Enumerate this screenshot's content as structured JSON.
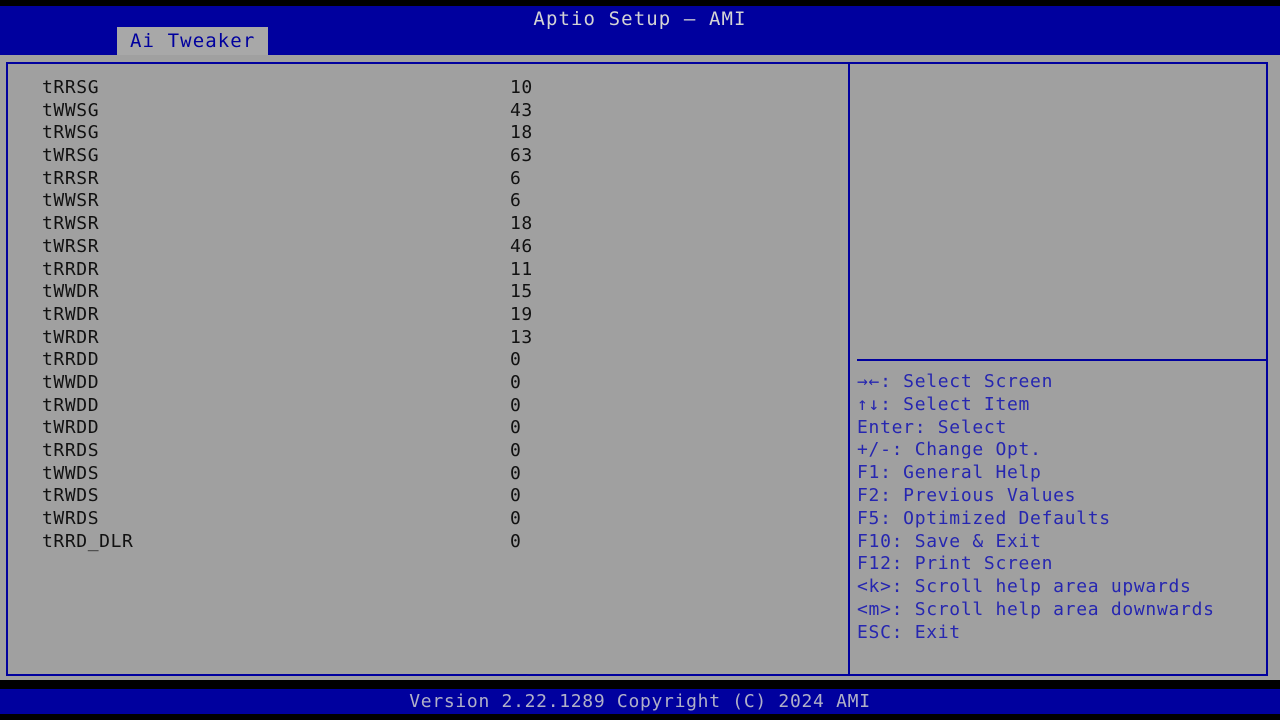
{
  "window": {
    "title": "Aptio Setup – AMI",
    "colors": {
      "header_blue": "#00009e",
      "body_gray": "#a0a0a0",
      "tab_gray": "#a8a8a8",
      "text_dark": "#111111",
      "legend_blue": "#2626b0",
      "footer_text": "#b0b0c8"
    }
  },
  "tabs": [
    {
      "label": "Ai Tweaker",
      "active": true
    }
  ],
  "settings": {
    "rows": [
      {
        "name": "tRRSG",
        "value": "10"
      },
      {
        "name": "tWWSG",
        "value": "43"
      },
      {
        "name": "tRWSG",
        "value": "18"
      },
      {
        "name": "tWRSG",
        "value": "63"
      },
      {
        "name": "tRRSR",
        "value": "6"
      },
      {
        "name": "tWWSR",
        "value": "6"
      },
      {
        "name": "tRWSR",
        "value": "18"
      },
      {
        "name": "tWRSR",
        "value": "46"
      },
      {
        "name": "tRRDR",
        "value": "11"
      },
      {
        "name": "tWWDR",
        "value": "15"
      },
      {
        "name": "tRWDR",
        "value": "19"
      },
      {
        "name": "tWRDR",
        "value": "13"
      },
      {
        "name": "tRRDD",
        "value": "0"
      },
      {
        "name": "tWWDD",
        "value": "0"
      },
      {
        "name": "tRWDD",
        "value": "0"
      },
      {
        "name": "tWRDD",
        "value": "0"
      },
      {
        "name": "tRRDS",
        "value": "0"
      },
      {
        "name": "tWWDS",
        "value": "0"
      },
      {
        "name": "tRWDS",
        "value": "0"
      },
      {
        "name": "tWRDS",
        "value": "0"
      },
      {
        "name": "tRRD_DLR",
        "value": "0"
      }
    ]
  },
  "help_panel": {
    "description": "",
    "legend": [
      {
        "key": "→←",
        "label": ": Select Screen"
      },
      {
        "key": "↑↓",
        "label": ": Select Item"
      },
      {
        "key": "Enter",
        "label": ": Select"
      },
      {
        "key": "+/-",
        "label": ": Change Opt."
      },
      {
        "key": "F1",
        "label": ": General Help"
      },
      {
        "key": "F2",
        "label": ": Previous Values"
      },
      {
        "key": "F5",
        "label": ": Optimized Defaults"
      },
      {
        "key": "F10",
        "label": ": Save & Exit"
      },
      {
        "key": "F12",
        "label": ": Print Screen"
      },
      {
        "key": "<k>",
        "label": ": Scroll help area upwards"
      },
      {
        "key": "<m>",
        "label": ": Scroll help area downwards"
      },
      {
        "key": "ESC",
        "label": ": Exit"
      }
    ]
  },
  "footer": {
    "version_text": "Version 2.22.1289 Copyright (C) 2024 AMI"
  }
}
